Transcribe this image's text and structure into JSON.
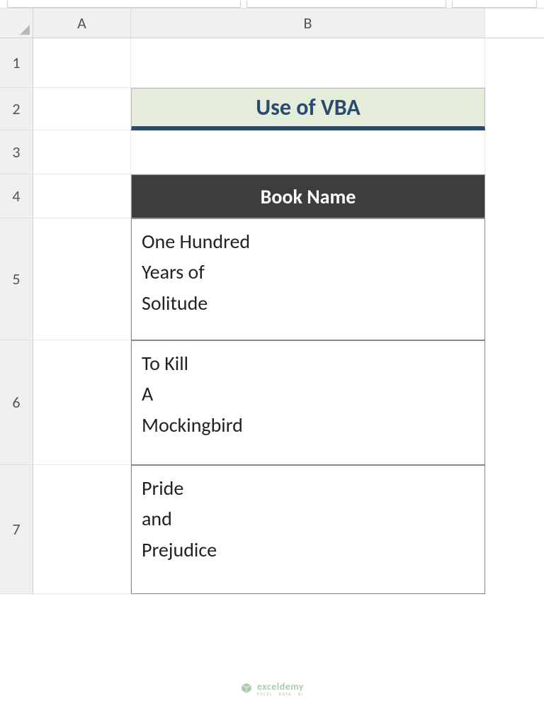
{
  "columns": {
    "A": "A",
    "B": "B"
  },
  "rows": {
    "r1": "1",
    "r2": "2",
    "r3": "3",
    "r4": "4",
    "r5": "5",
    "r6": "6",
    "r7": "7"
  },
  "title": "Use of VBA",
  "tableHeader": "Book Name",
  "books": {
    "b1": "One Hundred\nYears of\nSolitude",
    "b2": "To Kill\nA\nMockingbird",
    "b3": "Pride\nand\nPrejudice"
  },
  "watermark": {
    "brand": "exceldemy",
    "tag": "EXCEL · DATA · BI"
  }
}
